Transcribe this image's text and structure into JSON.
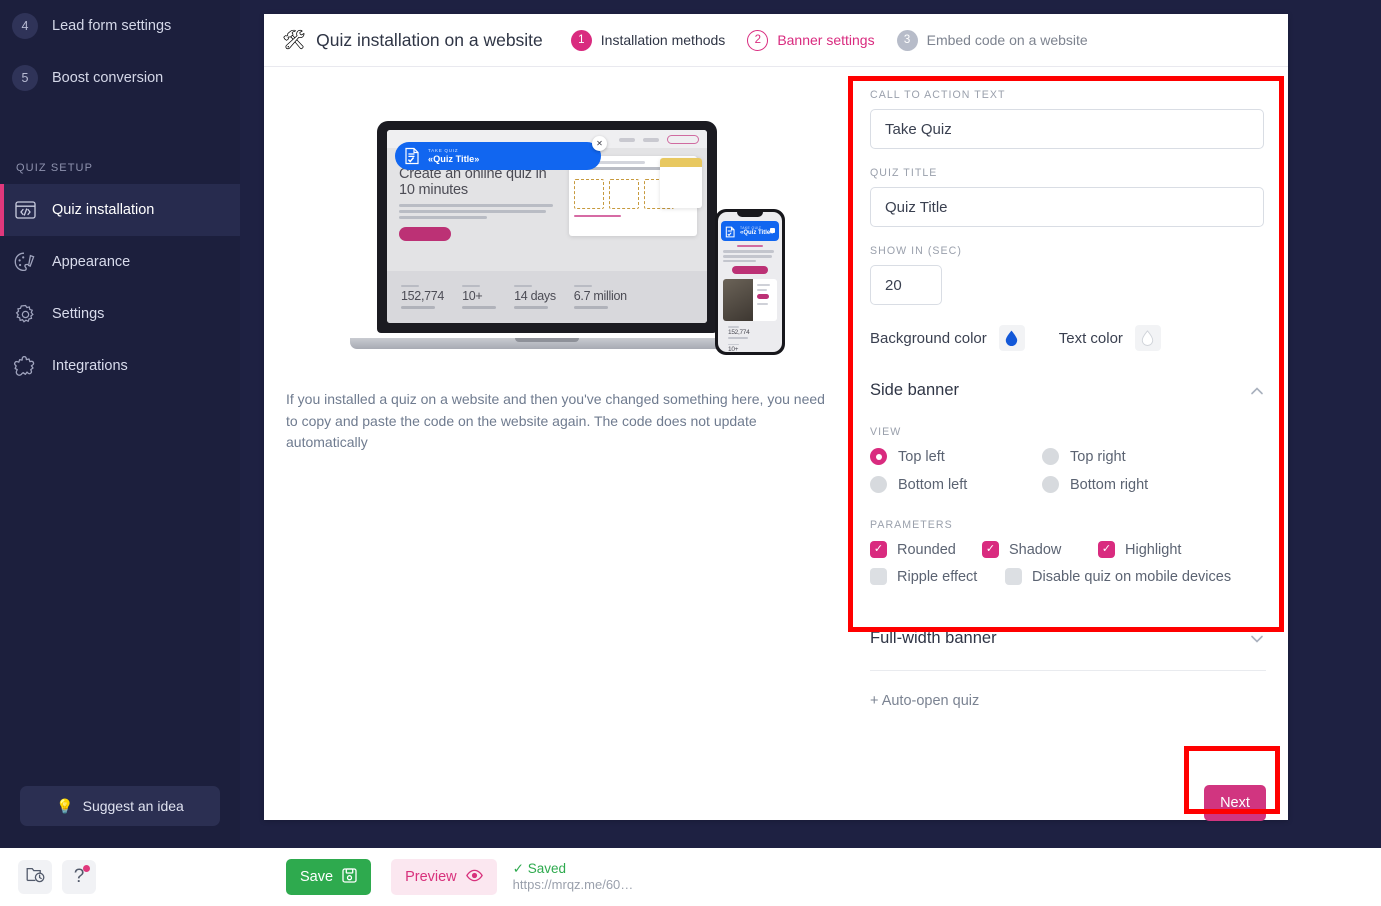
{
  "sidebar": {
    "numbered_items": [
      {
        "num": "4",
        "label": "Lead form settings"
      },
      {
        "num": "5",
        "label": "Boost conversion"
      }
    ],
    "group_title": "QUIZ SETUP",
    "items": [
      {
        "label": "Quiz installation",
        "icon": "code-window-icon",
        "active": true
      },
      {
        "label": "Appearance",
        "icon": "palette-icon",
        "active": false
      },
      {
        "label": "Settings",
        "icon": "gear-icon",
        "active": false
      },
      {
        "label": "Integrations",
        "icon": "puzzle-icon",
        "active": false
      }
    ],
    "suggest_label": "Suggest an idea",
    "suggest_icon": "lightbulb-icon"
  },
  "header": {
    "icon": "tools-icon",
    "title": "Quiz installation on a website",
    "steps": [
      {
        "num": "1",
        "label": "Installation methods",
        "state": "done"
      },
      {
        "num": "2",
        "label": "Banner settings",
        "state": "current"
      },
      {
        "num": "3",
        "label": "Embed code on a website",
        "state": "todo"
      }
    ]
  },
  "preview": {
    "banner": {
      "cta": "TAKE QUIZ",
      "title": "«Quiz Title»",
      "close_icon": "close-icon"
    },
    "site": {
      "headline": "Create an online quiz in 10 minutes",
      "stats": [
        {
          "value": "152,774"
        },
        {
          "value": "10+"
        },
        {
          "value": "14 days"
        },
        {
          "value": "6.7 million"
        }
      ]
    },
    "hint": "If you installed a quiz on a website and then you've changed something here, you need to copy and paste the code on the website again. The code does not update automatically"
  },
  "form": {
    "cta_label": "CALL TO ACTION TEXT",
    "cta_value": "Take Quiz",
    "cta_placeholder": "Take Quiz",
    "title_label": "QUIZ TITLE",
    "title_value": "Quiz Title",
    "title_placeholder": "Quiz Title",
    "delay_label": "SHOW IN (SEC)",
    "delay_value": "20",
    "delay_placeholder": "20",
    "background_color_label": "Background color",
    "background_color_value": "#1358d8",
    "text_color_label": "Text color",
    "text_color_value": "#ffffff",
    "side_banner": {
      "title": "Side banner",
      "expanded": true,
      "chevron_icon": "chevron-up-icon",
      "view_label": "VIEW",
      "view_options": [
        {
          "label": "Top left",
          "selected": true
        },
        {
          "label": "Top right",
          "selected": false
        },
        {
          "label": "Bottom left",
          "selected": false
        },
        {
          "label": "Bottom right",
          "selected": false
        }
      ],
      "parameters_label": "PARAMETERS",
      "parameters_row1": [
        {
          "label": "Rounded",
          "checked": true
        },
        {
          "label": "Shadow",
          "checked": true
        },
        {
          "label": "Highlight",
          "checked": true
        }
      ],
      "parameters_row2": [
        {
          "label": "Ripple effect",
          "checked": false
        },
        {
          "label": "Disable quiz on mobile devices",
          "checked": false
        }
      ]
    },
    "full_width_banner": {
      "title": "Full-width banner",
      "expanded": false,
      "chevron_icon": "chevron-down-icon"
    },
    "auto_open_label": "+ Auto-open quiz",
    "next_label": "Next"
  },
  "bottombar": {
    "history_icon": "folder-clock-icon",
    "help_icon": "question-mark-icon",
    "save_label": "Save",
    "save_icon": "floppy-disk-icon",
    "preview_label": "Preview",
    "preview_icon": "eye-icon",
    "saved_text": "✓ Saved",
    "saved_url": "https://mrqz.me/60…"
  },
  "annotations": {
    "accent_pink": "#d92b7f",
    "highlight_red": "#ff0000",
    "sidebar_bg": "#1c1f3d"
  }
}
